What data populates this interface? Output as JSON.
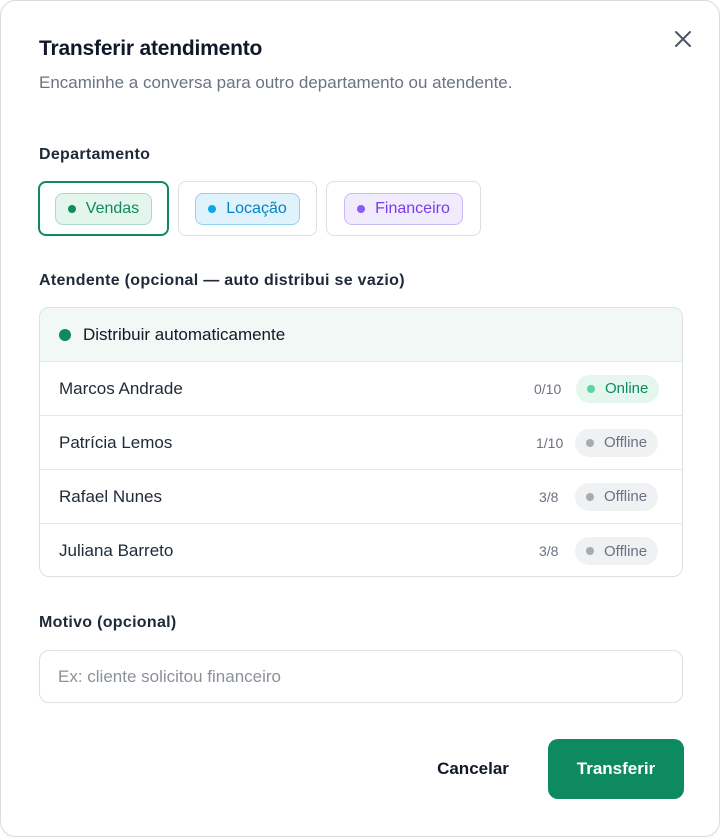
{
  "dialog": {
    "title": "Transferir atendimento",
    "subtitle": "Encaminhe a conversa para outro departamento ou atendente."
  },
  "close": {
    "icon": "close-icon"
  },
  "department": {
    "label": "Departamento",
    "options": [
      {
        "label": "Vendas",
        "color": "#0d8a60",
        "selected": true
      },
      {
        "label": "Locação",
        "color": "#0ea5e9",
        "selected": false
      },
      {
        "label": "Financeiro",
        "color": "#8b5cf6",
        "selected": false
      }
    ]
  },
  "attendant": {
    "label": "Atendente (opcional — auto distribui se vazio)",
    "auto_option": "Distribuir automaticamente",
    "agents": [
      {
        "name": "Marcos Andrade",
        "load": "0/10",
        "status": "Online"
      },
      {
        "name": "Patrícia Lemos",
        "load": "1/10",
        "status": "Offline"
      },
      {
        "name": "Rafael Nunes",
        "load": "3/8",
        "status": "Offline"
      },
      {
        "name": "Juliana Barreto",
        "load": "3/8",
        "status": "Offline"
      }
    ]
  },
  "reason": {
    "label": "Motivo (opcional)",
    "placeholder": "Ex: cliente solicitou financeiro",
    "value": ""
  },
  "actions": {
    "cancel": "Cancelar",
    "submit": "Transferir"
  },
  "colors": {
    "primary": "#0d8a60",
    "online_bg": "#e4f6ee",
    "offline_bg": "#f0f1f3"
  }
}
